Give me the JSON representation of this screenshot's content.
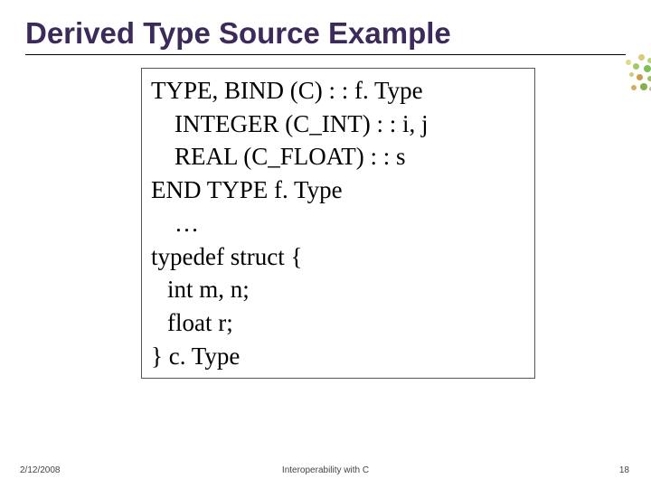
{
  "title": "Derived Type Source Example",
  "code": {
    "l1": "TYPE, BIND (C) : : f. Type",
    "l2": "INTEGER (C_INT) : : i, j",
    "l3": "REAL (C_FLOAT) : : s",
    "l4": "END TYPE f. Type",
    "l5": "…",
    "l6": "typedef struct {",
    "l7": "int m, n;",
    "l8": "float r;",
    "l9": "} c. Type"
  },
  "footer": {
    "date": "2/12/2008",
    "center": "Interoperability with C",
    "page": "18"
  }
}
